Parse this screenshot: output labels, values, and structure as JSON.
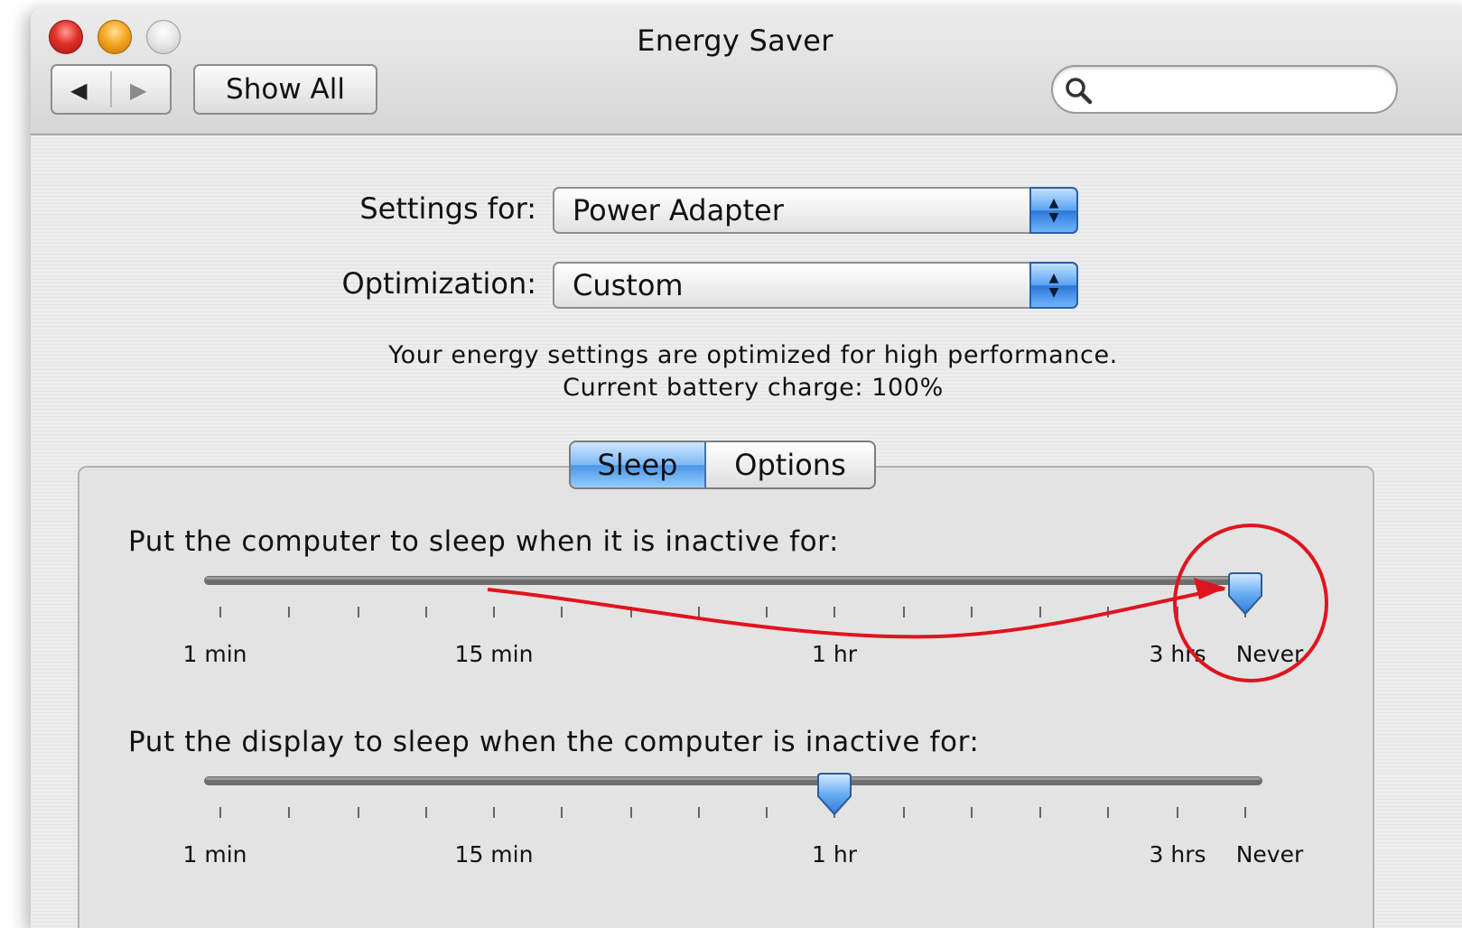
{
  "window": {
    "title": "Energy Saver"
  },
  "toolbar": {
    "back_glyph": "◀",
    "forward_glyph": "▶",
    "show_all": "Show All",
    "search": {
      "placeholder": "",
      "value": ""
    }
  },
  "settings_for": {
    "label": "Settings for:",
    "value": "Power Adapter"
  },
  "optimization": {
    "label": "Optimization:",
    "value": "Custom"
  },
  "info": {
    "line1": "Your energy settings are optimized for high performance.",
    "line2": "Current battery charge: 100%"
  },
  "tabs": [
    {
      "label": "Sleep",
      "selected": true
    },
    {
      "label": "Options",
      "selected": false
    }
  ],
  "sliders": {
    "computer": {
      "label": "Put the computer to sleep when it is inactive for:",
      "value": "Never",
      "tick_labels": [
        "1 min",
        "15 min",
        "1 hr",
        "3 hrs",
        "Never"
      ]
    },
    "display": {
      "label": "Put the display to sleep when the computer is inactive for:",
      "value": "1 hr",
      "tick_labels": [
        "1 min",
        "15 min",
        "1 hr",
        "3 hrs",
        "Never"
      ]
    }
  },
  "colors": {
    "accent_blue": "#4b95e6",
    "annotation_red": "#e0141e"
  },
  "icons": [
    "close-icon",
    "minimize-icon",
    "zoom-icon",
    "back-arrow-icon",
    "forward-arrow-icon",
    "search-icon",
    "popup-stepper-icon",
    "slider-thumb-icon"
  ]
}
